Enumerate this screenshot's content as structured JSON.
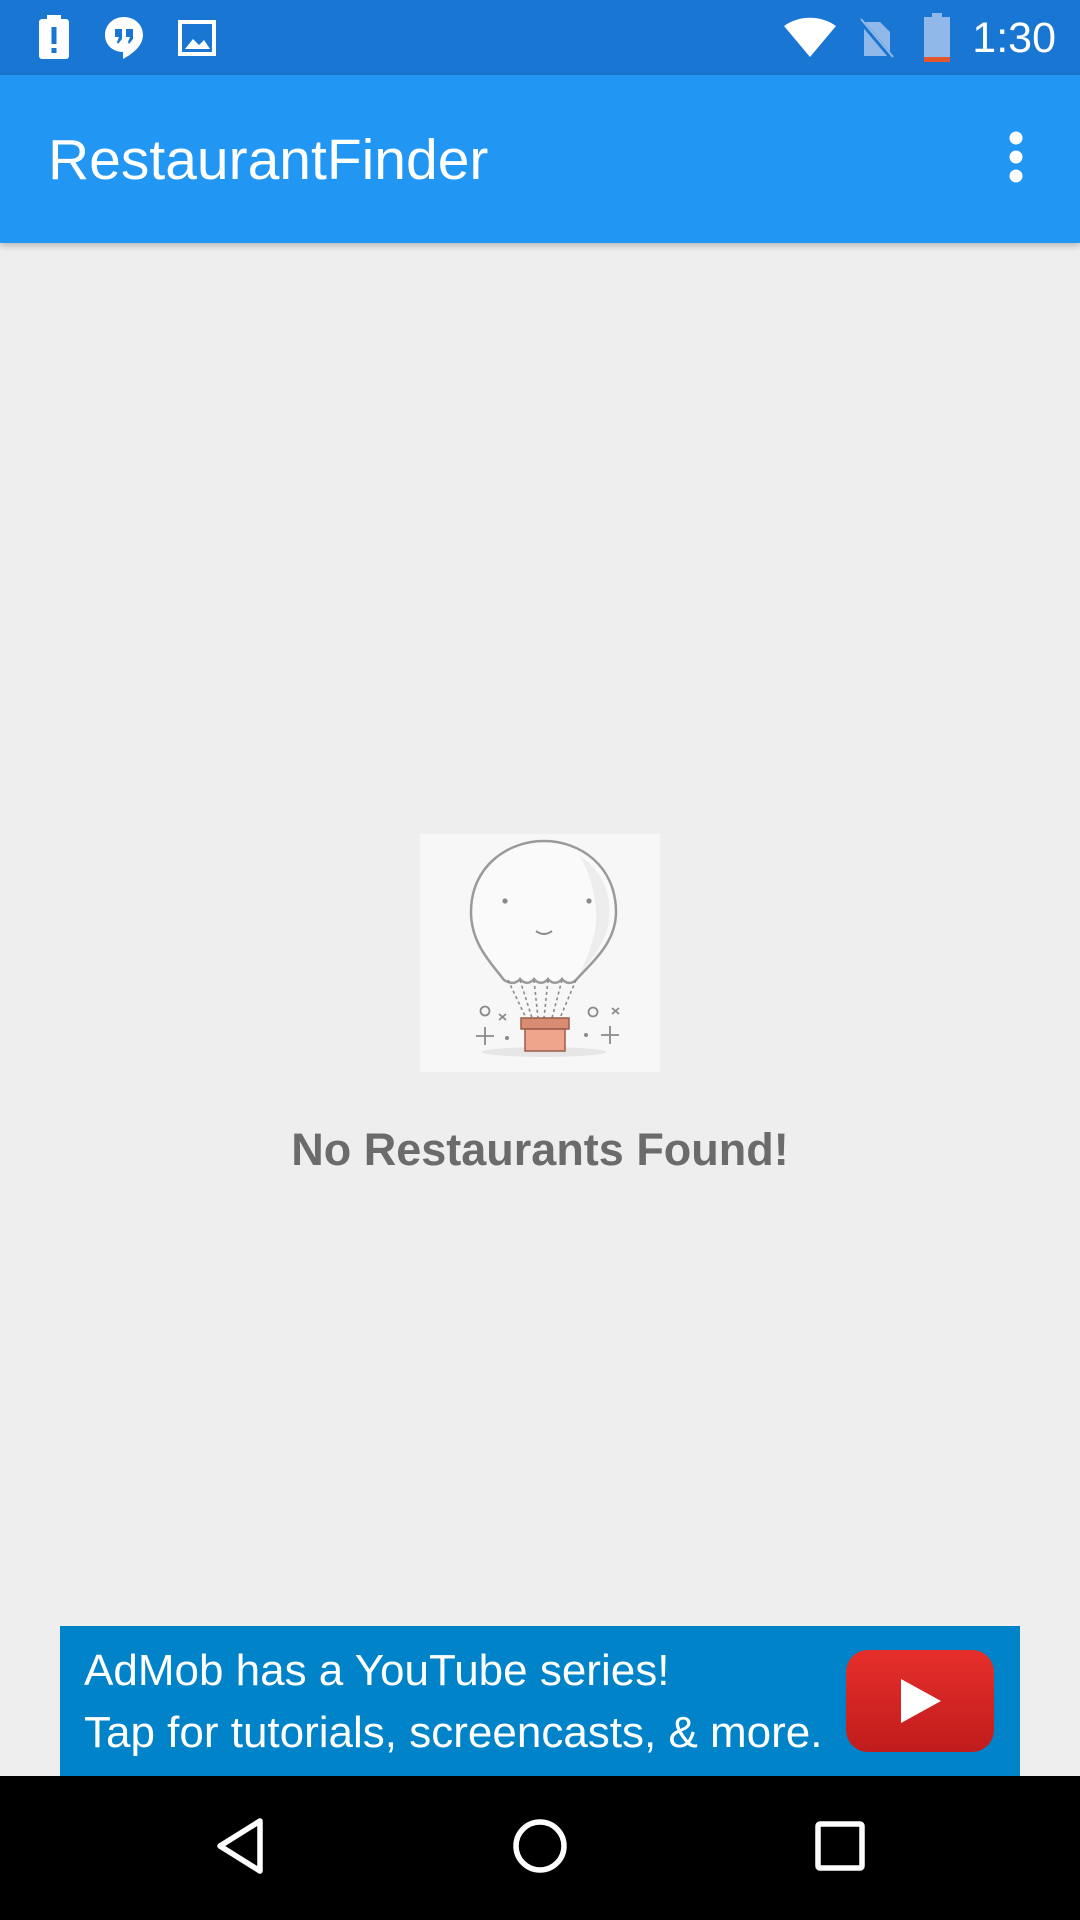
{
  "status_bar": {
    "time": "1:30",
    "notification_icons": [
      "alert-notification-icon",
      "hangouts-quote-icon",
      "image-notification-icon"
    ],
    "system_icons": [
      "wifi-icon",
      "no-sim-icon",
      "battery-low-icon"
    ]
  },
  "app_bar": {
    "title": "RestaurantFinder",
    "overflow_icon": "more-vert-icon"
  },
  "empty_state": {
    "illustration": "hot-air-balloon-illustration",
    "message": "No Restaurants Found!"
  },
  "ad_banner": {
    "line1": "AdMob has a YouTube series!",
    "line2": "Tap for tutorials, screencasts, & more.",
    "icon": "youtube-play-icon"
  },
  "nav_bar": {
    "buttons": [
      "back-icon",
      "home-icon",
      "recents-icon"
    ]
  },
  "colors": {
    "status_bar": "#1976d2",
    "app_bar": "#2196f3",
    "background": "#eeeeee",
    "ad_background": "#0083c8",
    "youtube_red": "#e62f2b",
    "empty_text": "#6b6b6b"
  }
}
